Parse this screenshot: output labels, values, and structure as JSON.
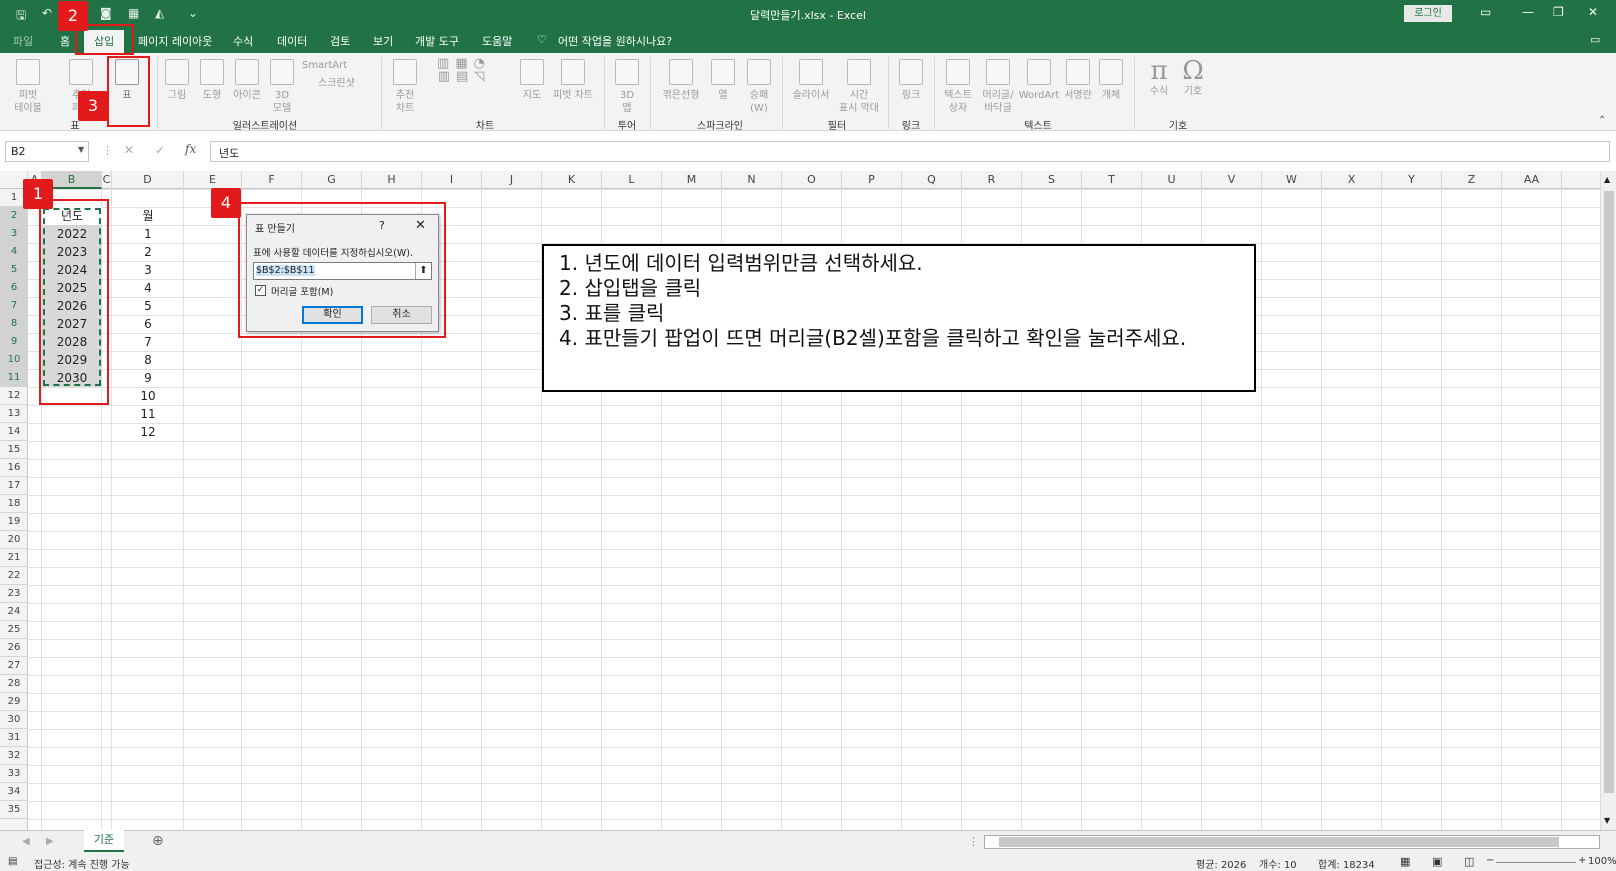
{
  "window": {
    "title": "달력만들기.xlsx  -  Excel",
    "login_label": "로그인"
  },
  "ribbon_tabs": [
    "파일",
    "홈",
    "삽입",
    "페이지 레이아웃",
    "수식",
    "데이터",
    "검토",
    "보기",
    "개발 도구",
    "도움말"
  ],
  "active_tab": "삽입",
  "tell_me": "어떤 작업을 원하시나요?",
  "ribbon_buttons": {
    "pivot_table": "피벗\n테이블",
    "recommended_pivot": "추천\n피벗",
    "table": "표",
    "picture": "그림",
    "shapes": "도형",
    "icons": "아이콘",
    "models3d": "3D\n모델",
    "smartart": "SmartArt",
    "screenshot": "스크린샷",
    "rec_charts": "추천\n차트",
    "maps": "지도",
    "pivot_chart": "피벗 차트",
    "map3d": "3D\n맵",
    "line": "꺾은선형",
    "column": "열",
    "winloss": "승패\n(W)",
    "slicer": "슬라이서",
    "timeline": "시간\n표시 막대",
    "link": "링크",
    "textbox": "텍스트\n상자",
    "header_footer": "머리글/\n바닥글",
    "wordart": "WordArt",
    "signature": "서명란",
    "object": "개체",
    "equation": "수식",
    "symbol": "기호"
  },
  "ribbon_groups": [
    "표",
    "일러스트레이션",
    "차트",
    "투어",
    "스파크라인",
    "필터",
    "링크",
    "텍스트",
    "기호"
  ],
  "formula_bar": {
    "name_box": "B2",
    "formula": "년도"
  },
  "columns": [
    "A",
    "B",
    "C",
    "D",
    "E",
    "F",
    "G",
    "H",
    "I",
    "J",
    "K",
    "L",
    "M",
    "N",
    "O",
    "P",
    "Q",
    "R",
    "S",
    "T",
    "U",
    "V",
    "W",
    "X",
    "Y",
    "Z",
    "AA"
  ],
  "rows": [
    "1",
    "2",
    "3",
    "4",
    "5",
    "6",
    "7",
    "8",
    "9",
    "10",
    "11",
    "12",
    "13",
    "14",
    "15",
    "16",
    "17",
    "18",
    "19",
    "20",
    "21",
    "22",
    "23",
    "24",
    "25",
    "26",
    "27",
    "28",
    "29",
    "30",
    "31",
    "32",
    "33",
    "34",
    "35"
  ],
  "col_b": [
    "년도",
    "2022",
    "2023",
    "2024",
    "2025",
    "2026",
    "2027",
    "2028",
    "2029",
    "2030"
  ],
  "col_d": [
    "월",
    "1",
    "2",
    "3",
    "4",
    "5",
    "6",
    "7",
    "8",
    "9",
    "10",
    "11",
    "12"
  ],
  "dialog": {
    "title": "표 만들기",
    "help": "?",
    "prompt": "표에 사용할 데이터를 지정하십시오(W).",
    "range": "$B$2:$B$11",
    "checkbox_label": "머리글 포함(M)",
    "checkbox_checked": true,
    "ok": "확인",
    "cancel": "취소"
  },
  "badges": [
    "1",
    "2",
    "3",
    "4"
  ],
  "instructions": [
    "1. 년도에 데이터 입력범위만큼 선택하세요.",
    "2. 삽입탭을 클릭",
    "3. 표를 클릭",
    "4. 표만들기 팝업이 뜨면 머리글(B2셀)포함을 클릭하고 확인을 눌러주세요."
  ],
  "sheet_tab": "기준",
  "status": {
    "accessibility": "접근성: 계속 진행 가능",
    "average": "평균: 2026",
    "count": "개수: 10",
    "sum": "합계: 18234",
    "zoom": "100%"
  },
  "colors": {
    "excel_green": "#217346",
    "highlight_red": "#e31a1c"
  }
}
